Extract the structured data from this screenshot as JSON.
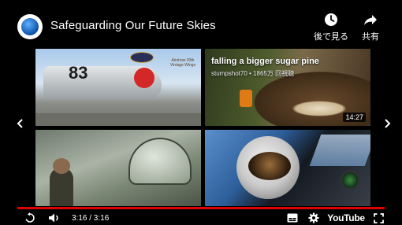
{
  "video": {
    "title": "Safeguarding Our Future Skies"
  },
  "top_actions": {
    "watch_later_label": "後で見る",
    "share_label": "共有"
  },
  "tiles": {
    "tile1": {
      "plane_number": "83",
      "event_text": "Airshow 20th Vintage Wings"
    },
    "tile2": {
      "title": "falling a bigger sugar pine",
      "meta": "stumpshot70 • 1865万 回視聴",
      "duration": "14:27"
    }
  },
  "player": {
    "current_time": "3:16",
    "duration": "3:16",
    "time_display": "3:16 / 3:16",
    "progress_fraction": 1.0,
    "brand_label": "YouTube"
  },
  "colors": {
    "progress": "#e00000",
    "background": "#000000"
  },
  "icons": {
    "watch_later": "clock-icon",
    "share": "share-arrow-icon",
    "prev": "chevron-left-icon",
    "next": "chevron-right-icon",
    "replay": "replay-icon",
    "volume": "volume-icon",
    "subtitles": "subtitles-icon",
    "settings": "gear-icon",
    "fullscreen": "fullscreen-icon"
  }
}
